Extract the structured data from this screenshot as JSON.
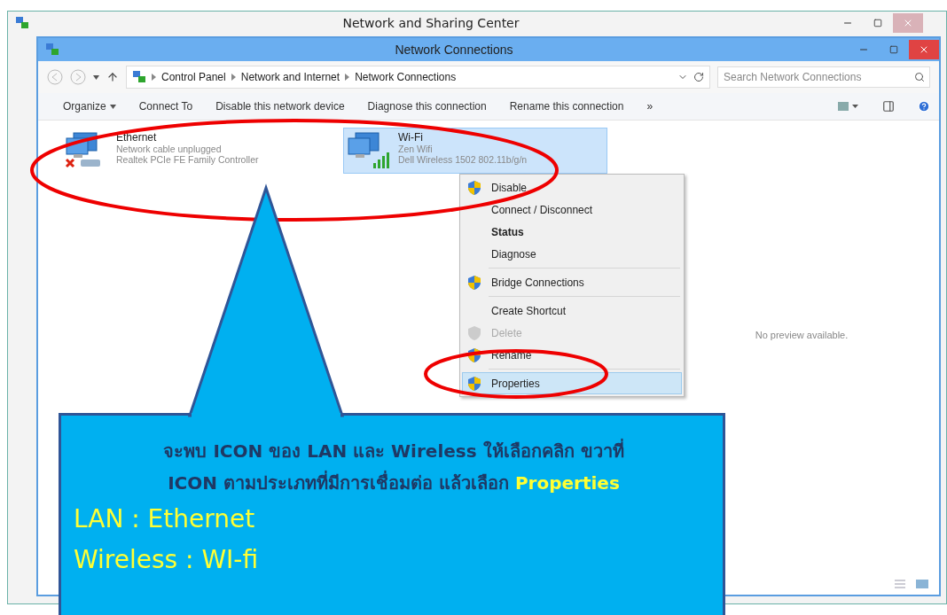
{
  "outer_window": {
    "title": "Network and Sharing Center"
  },
  "window": {
    "title": "Network Connections"
  },
  "address": {
    "path": [
      "Control Panel",
      "Network and Internet",
      "Network Connections"
    ],
    "search_placeholder": "Search Network Connections"
  },
  "toolbar": {
    "items": [
      {
        "label": "Organize",
        "dropdown": true
      },
      {
        "label": "Connect To",
        "dropdown": false
      },
      {
        "label": "Disable this network device",
        "dropdown": false
      },
      {
        "label": "Diagnose this connection",
        "dropdown": false
      },
      {
        "label": "Rename this connection",
        "dropdown": false
      }
    ],
    "overflow": "»"
  },
  "connections": [
    {
      "kind": "ethernet",
      "name": "Ethernet",
      "status": "Network cable unplugged",
      "device": "Realtek PCIe FE Family Controller",
      "selected": false
    },
    {
      "kind": "wifi",
      "name": "Wi-Fi",
      "status": "Zen Wifi",
      "device": "Dell Wireless 1502 802.11b/g/n",
      "selected": true
    }
  ],
  "context_menu": [
    {
      "kind": "item",
      "label": "Disable",
      "shield": true,
      "bold": false,
      "disabled": false,
      "selected": false
    },
    {
      "kind": "item",
      "label": "Connect / Disconnect",
      "shield": false,
      "bold": false,
      "disabled": false,
      "selected": false
    },
    {
      "kind": "item",
      "label": "Status",
      "shield": false,
      "bold": true,
      "disabled": false,
      "selected": false
    },
    {
      "kind": "item",
      "label": "Diagnose",
      "shield": false,
      "bold": false,
      "disabled": false,
      "selected": false
    },
    {
      "kind": "separator"
    },
    {
      "kind": "item",
      "label": "Bridge Connections",
      "shield": true,
      "bold": false,
      "disabled": false,
      "selected": false
    },
    {
      "kind": "separator"
    },
    {
      "kind": "item",
      "label": "Create Shortcut",
      "shield": false,
      "bold": false,
      "disabled": false,
      "selected": false
    },
    {
      "kind": "item",
      "label": "Delete",
      "shield": true,
      "bold": false,
      "disabled": true,
      "selected": false
    },
    {
      "kind": "item",
      "label": "Rename",
      "shield": true,
      "bold": false,
      "disabled": false,
      "selected": false
    },
    {
      "kind": "separator"
    },
    {
      "kind": "item",
      "label": "Properties",
      "shield": true,
      "bold": false,
      "disabled": false,
      "selected": true
    }
  ],
  "preview": {
    "message": "No preview available."
  },
  "callout": {
    "instruction": [
      [
        {
          "text": "จะพบ ICON  ของ LAN และ Wireless  ให้เลือกคลิก ขวาที่",
          "highlight": false
        }
      ],
      [
        {
          "text": "ICON ตามประเภทที่มีการเชื่อมต่อ แล้วเลือก ",
          "highlight": false
        },
        {
          "text": "Properties",
          "highlight": true
        }
      ]
    ],
    "notes": [
      "LAN : Ethernet",
      "Wireless :  WI-fi"
    ]
  }
}
